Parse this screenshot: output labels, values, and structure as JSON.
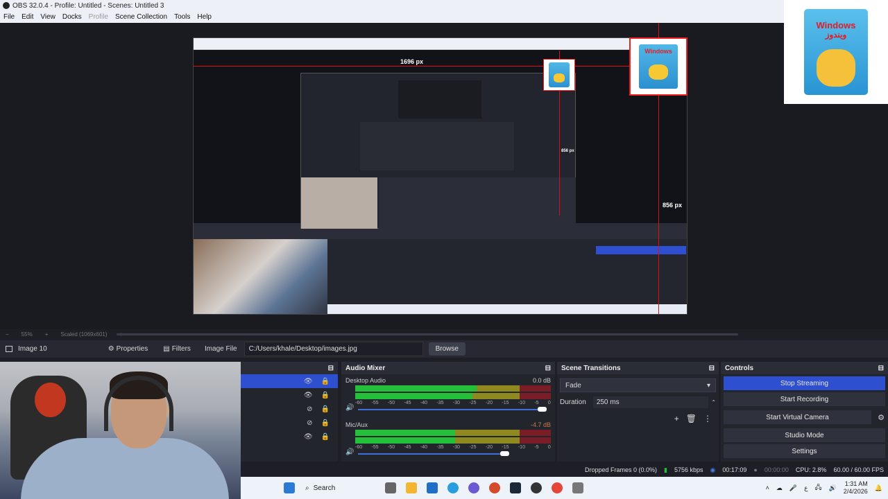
{
  "window": {
    "title": "OBS 32.0.4 - Profile: Untitled - Scenes: Untitled 3"
  },
  "menu": {
    "items": [
      "File",
      "Edit",
      "View",
      "Docks",
      "Profile",
      "Scene Collection",
      "Tools",
      "Help"
    ],
    "disabled_index": 4
  },
  "preview": {
    "label_top": "1696 px",
    "label_mid": "856 px",
    "label_right": "856 px",
    "corner_brand_top": "Windows",
    "corner_brand_ar": "ويندوز",
    "zoom": "55%",
    "scale_label": "Scaled (1069x601)"
  },
  "source_bar": {
    "source_name": "Image 10",
    "properties_label": "Properties",
    "filters_label": "Filters",
    "image_file_label": "Image File",
    "image_path": "C:/Users/khale/Desktop/images.jpg",
    "browse_label": "Browse"
  },
  "audio_mixer": {
    "title": "Audio Mixer",
    "channels": [
      {
        "name": "Desktop Audio",
        "db": "0.0 dB",
        "level": 0.62,
        "volume": 1.0
      },
      {
        "name": "Mic/Aux",
        "db": "-4.7 dB",
        "level": 0.51,
        "volume": 0.78
      }
    ],
    "scale": [
      "-60",
      "-55",
      "-50",
      "-45",
      "-40",
      "-35",
      "-30",
      "-25",
      "-20",
      "-15",
      "-10",
      "-5",
      "0"
    ]
  },
  "scene_transitions": {
    "title": "Scene Transitions",
    "selected": "Fade",
    "duration_label": "Duration",
    "duration_value": "250 ms"
  },
  "controls": {
    "title": "Controls",
    "stop_streaming": "Stop Streaming",
    "start_recording": "Start Recording",
    "start_virtual_camera": "Start Virtual Camera",
    "studio_mode": "Studio Mode",
    "settings": "Settings"
  },
  "status": {
    "dropped_frames": "Dropped Frames 0 (0.0%)",
    "bitrate": "5756 kbps",
    "stream_time": "00:17:09",
    "rec_time": "00:00:00",
    "cpu": "CPU: 2.8%",
    "fps": "60.00 / 60.00 FPS"
  },
  "taskbar": {
    "search_label": "Search",
    "time": "1:31 AM",
    "date": "2/4/2026",
    "lang": "ع"
  },
  "colors": {
    "accent": "#2f4fd1",
    "guide": "#d11111"
  }
}
